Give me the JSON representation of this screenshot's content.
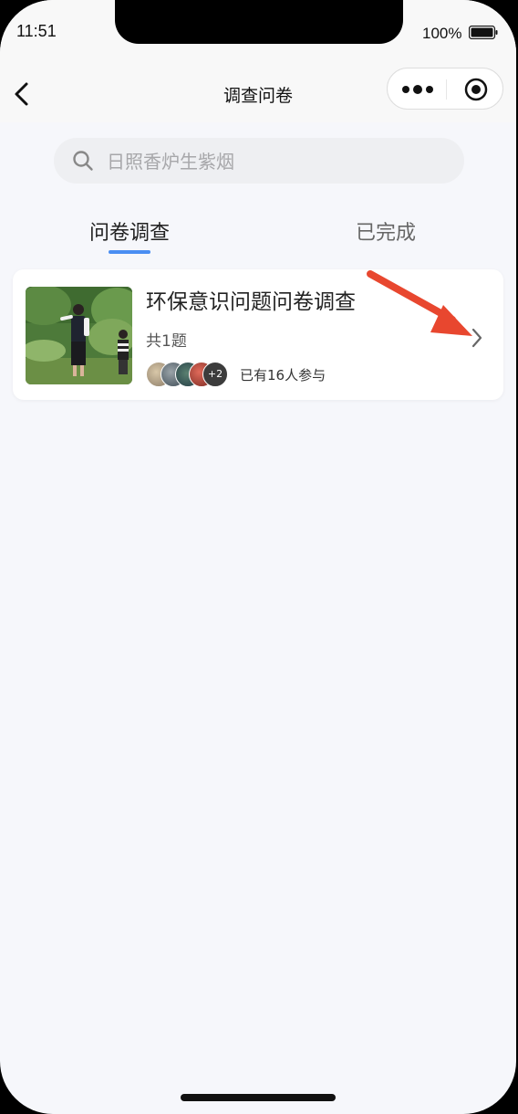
{
  "status_bar": {
    "time": "11:51",
    "battery": "100%"
  },
  "nav": {
    "title": "调查问卷"
  },
  "search": {
    "placeholder": "日照香炉生紫烟"
  },
  "tabs": [
    {
      "label": "问卷调查",
      "active": true
    },
    {
      "label": "已完成",
      "active": false
    }
  ],
  "survey_card": {
    "title": "环保意识问题问卷调查",
    "question_count": "共1题",
    "avatar_more": "+2",
    "participants": "已有16人参与"
  },
  "colors": {
    "accent": "#4a8ef2",
    "annotation_arrow": "#e8472f"
  }
}
